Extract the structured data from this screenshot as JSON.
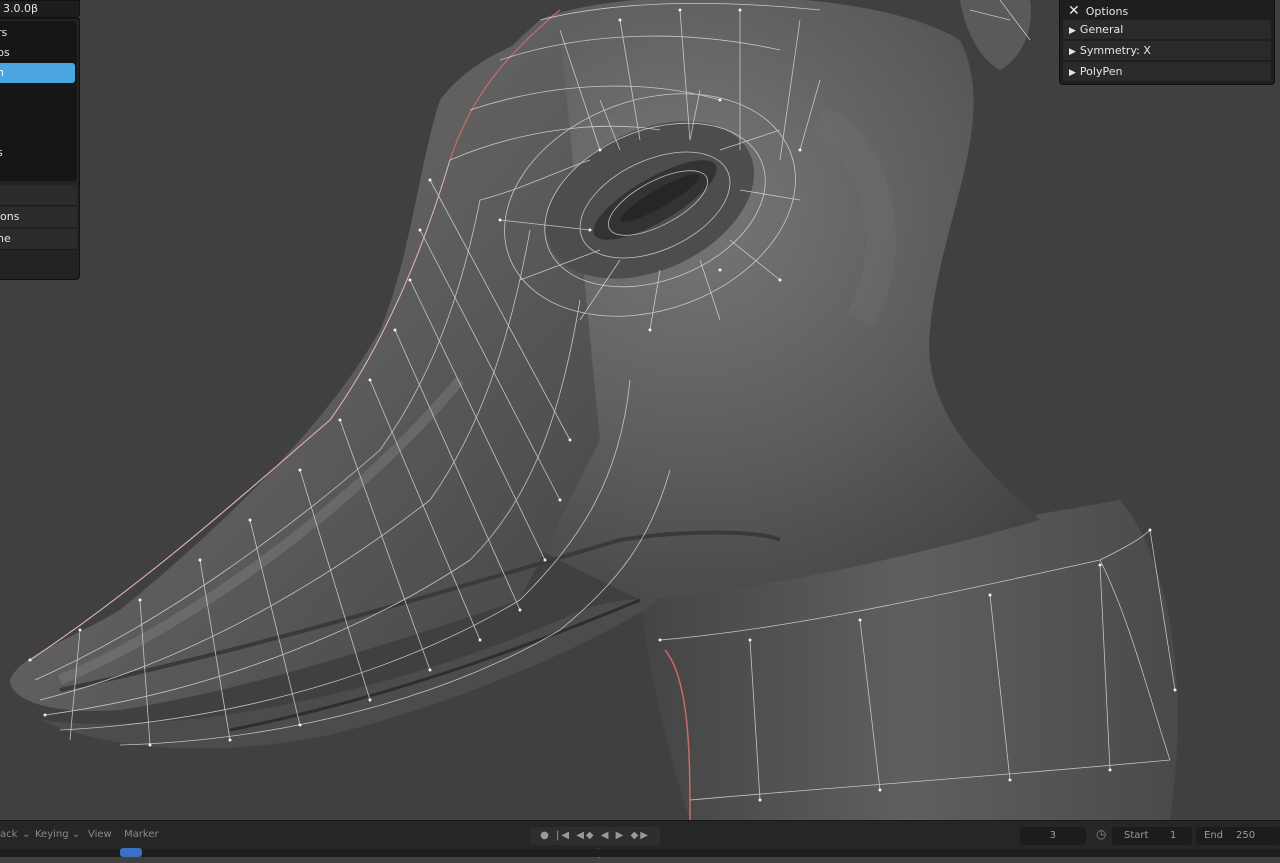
{
  "left_panel": {
    "title": "3.0.0β",
    "list_items": [
      "rs",
      "ps",
      "n",
      "",
      "",
      "s"
    ],
    "selected_index": 2,
    "rows": [
      "",
      "ions",
      "ne"
    ]
  },
  "options_panel": {
    "title": "Options",
    "close_icon": "close-icon",
    "sections": [
      {
        "label": "General",
        "icon": "expand-triangle-icon"
      },
      {
        "label": "Symmetry: X",
        "icon": "expand-triangle-icon"
      },
      {
        "label": "PolyPen",
        "icon": "expand-triangle-icon"
      }
    ]
  },
  "timeline": {
    "menu_items": [
      "ack",
      "Keying",
      "View",
      "Marker"
    ],
    "current_frame": "3",
    "start_label": "Start",
    "start_value": "1",
    "end_label": "End",
    "end_value": "250",
    "playback_icons": "● |◀ ◀◆ ◀ ▶ ◆▶ ▶|"
  },
  "colors": {
    "viewport_bg": "#404040",
    "selection_accent": "#4aa5e0",
    "panel_bg": "#1e1e1e",
    "mesh_wire": "#d8d8d8",
    "seam": "#c86a6a"
  }
}
